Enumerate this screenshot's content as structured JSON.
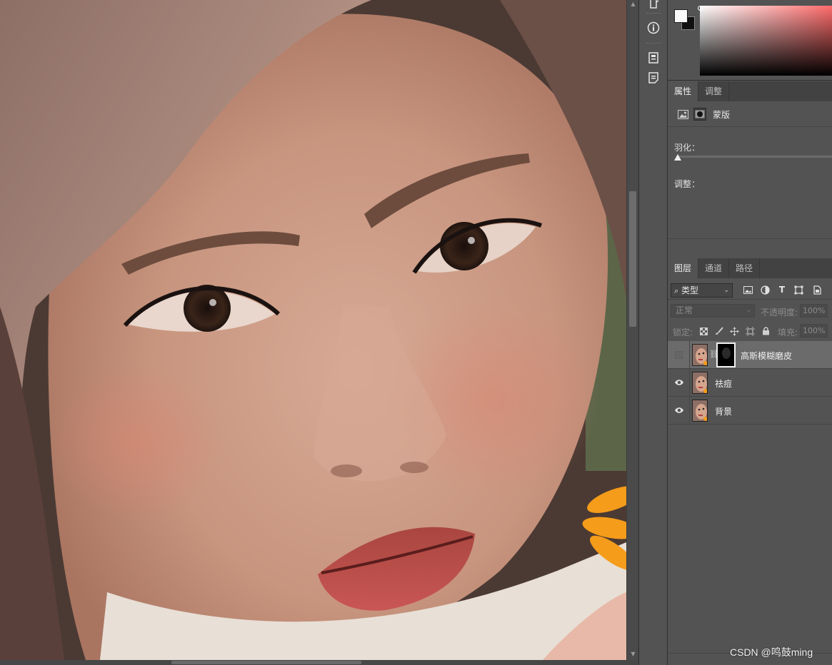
{
  "properties_panel": {
    "tabs": [
      {
        "label": "属性"
      },
      {
        "label": "调整"
      }
    ],
    "mask_label": "蒙版",
    "feather_label": "羽化：",
    "adjust_label": "调整："
  },
  "layers_panel": {
    "tabs": [
      {
        "label": "图层"
      },
      {
        "label": "通道"
      },
      {
        "label": "路径"
      }
    ],
    "filter_kind": "类型",
    "blend_mode": "正常",
    "opacity_label": "不透明度:",
    "opacity_value": "100%",
    "lock_label": "锁定:",
    "fill_label": "填充:",
    "fill_value": "100%",
    "layers": [
      {
        "name": "高斯模糊磨皮",
        "visible": false,
        "selected": true,
        "has_mask": true
      },
      {
        "name": "祛痘",
        "visible": true,
        "selected": false,
        "has_mask": false
      },
      {
        "name": "背景",
        "visible": true,
        "selected": false,
        "has_mask": false
      }
    ]
  },
  "colors": {
    "foreground": "#fafafa",
    "background": "#111111",
    "spectrum_hue": "#ff6b6b",
    "panel_bg": "#535353",
    "selected_layer_bg": "#6b6b6b"
  },
  "toolstrip": {
    "icons": [
      "history-icon",
      "info-icon",
      "properties-icon",
      "notes-icon"
    ]
  },
  "watermark": "CSDN @鸣鼓ming"
}
